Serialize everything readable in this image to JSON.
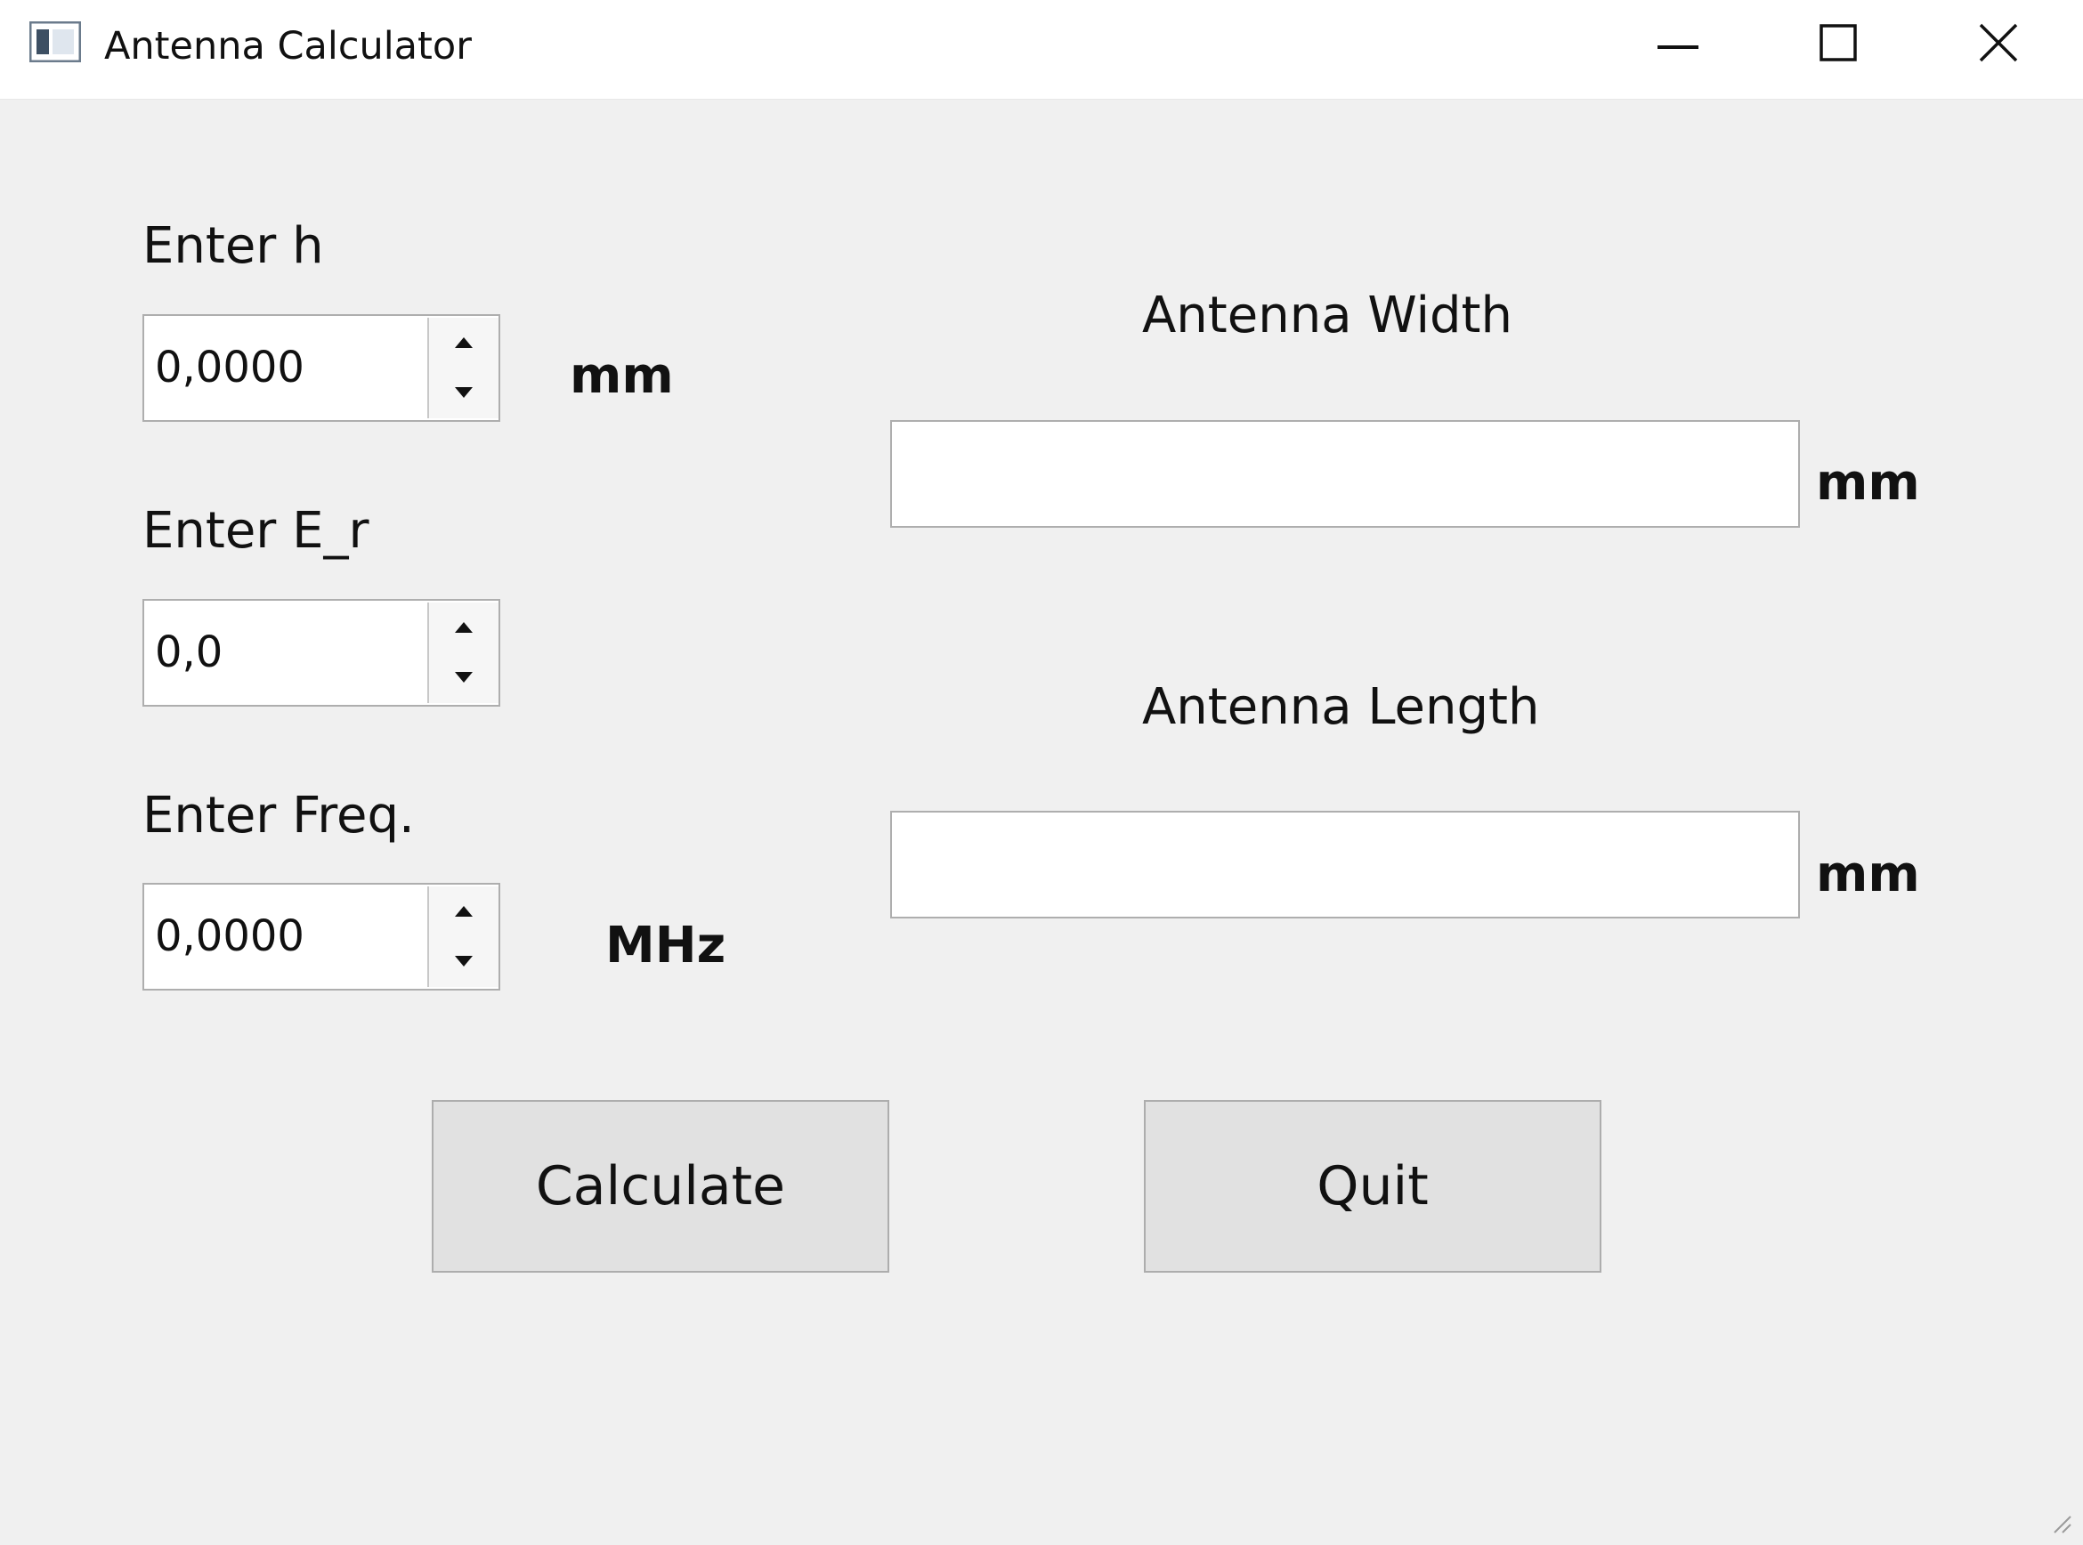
{
  "window": {
    "title": "Antenna Calculator",
    "icon": "app-window-icon",
    "controls": {
      "minimize_icon": "minimize-icon",
      "maximize_icon": "maximize-icon",
      "close_icon": "close-icon"
    }
  },
  "inputs": {
    "h": {
      "label": "Enter h",
      "value": "0,0000",
      "unit": "mm"
    },
    "er": {
      "label": "Enter E_r",
      "value": "0,0"
    },
    "freq": {
      "label": "Enter Freq.",
      "value": "0,0000",
      "unit": "MHz"
    }
  },
  "outputs": {
    "width": {
      "label": "Antenna Width",
      "value": "",
      "unit": "mm"
    },
    "length": {
      "label": "Antenna Length",
      "value": "",
      "unit": "mm"
    }
  },
  "buttons": {
    "calculate": "Calculate",
    "quit": "Quit"
  },
  "colors": {
    "background": "#f0f0f0",
    "titlebar": "#ffffff",
    "button_face": "#e1e1e1",
    "field_border": "#aeaeae"
  }
}
